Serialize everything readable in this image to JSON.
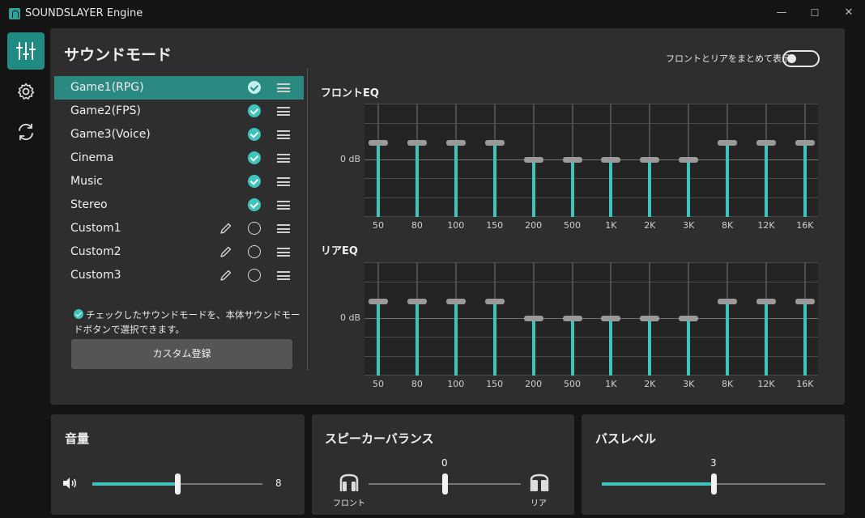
{
  "window": {
    "title": "SOUNDSLAYER Engine",
    "minimize": "—",
    "maximize": "☐",
    "close": "✕"
  },
  "rail": {
    "items": [
      {
        "icon": "equalizer-sliders-icon",
        "active": true
      },
      {
        "icon": "gear-icon",
        "active": false
      },
      {
        "icon": "sync-icon",
        "active": false
      }
    ]
  },
  "sound_mode": {
    "title": "サウンドモード",
    "combine_label": "フロントとリアをまとめて表示",
    "combine_on": false,
    "modes": [
      {
        "name": "Game1(RPG)",
        "checked": true,
        "editable": false,
        "selected": true
      },
      {
        "name": "Game2(FPS)",
        "checked": true,
        "editable": false,
        "selected": false
      },
      {
        "name": "Game3(Voice)",
        "checked": true,
        "editable": false,
        "selected": false
      },
      {
        "name": "Cinema",
        "checked": true,
        "editable": false,
        "selected": false
      },
      {
        "name": "Music",
        "checked": true,
        "editable": false,
        "selected": false
      },
      {
        "name": "Stereo",
        "checked": true,
        "editable": false,
        "selected": false
      },
      {
        "name": "Custom1",
        "checked": false,
        "editable": true,
        "selected": false
      },
      {
        "name": "Custom2",
        "checked": false,
        "editable": true,
        "selected": false
      },
      {
        "name": "Custom3",
        "checked": false,
        "editable": true,
        "selected": false
      }
    ],
    "note": "チェックしたサウンドモードを、本体サウンドモードボタンで選択できます。",
    "custom_register_label": "カスタム登録"
  },
  "eq": {
    "zero_label": "0 dB",
    "frequencies": [
      "50",
      "80",
      "100",
      "150",
      "200",
      "500",
      "1K",
      "2K",
      "3K",
      "8K",
      "12K",
      "16K"
    ],
    "front": {
      "title": "フロントEQ",
      "levels": [
        1,
        1,
        1,
        1,
        0,
        0,
        0,
        0,
        0,
        1,
        1,
        1
      ]
    },
    "rear": {
      "title": "リアEQ",
      "levels": [
        1,
        1,
        1,
        1,
        0,
        0,
        0,
        0,
        0,
        1,
        1,
        1
      ]
    }
  },
  "volume": {
    "title": "音量",
    "value": 8,
    "value_text": "8",
    "fraction": 0.5,
    "icon": "speaker-volume-icon"
  },
  "balance": {
    "title": "スピーカーバランス",
    "value": 0,
    "value_text": "0",
    "fraction": 0.5,
    "front_label": "フロント",
    "rear_label": "リア",
    "front_icon": "front-speaker-icon",
    "rear_icon": "rear-speaker-icon"
  },
  "bass": {
    "title": "バスレベル",
    "value": 3,
    "value_text": "3",
    "fraction": 0.5
  },
  "colors": {
    "accent": "#3ec4bc",
    "selected_row": "#2a8a82",
    "panel": "#2e2e2e",
    "background": "#141414"
  }
}
